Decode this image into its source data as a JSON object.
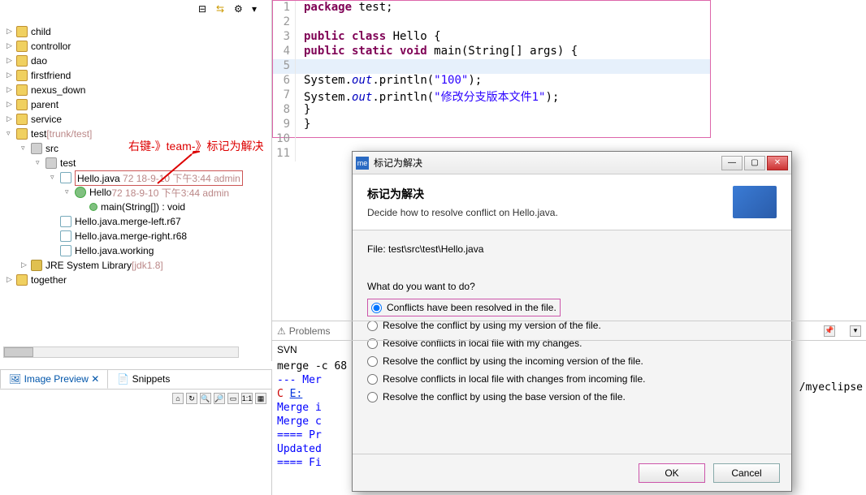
{
  "tree": [
    {
      "ind": 0,
      "arr": "▷",
      "icon": "fld",
      "t": "child"
    },
    {
      "ind": 0,
      "arr": "▷",
      "icon": "fld",
      "t": "controllor"
    },
    {
      "ind": 0,
      "arr": "▷",
      "icon": "fld",
      "t": "dao"
    },
    {
      "ind": 0,
      "arr": "▷",
      "icon": "fld",
      "t": "firstfriend"
    },
    {
      "ind": 0,
      "arr": "▷",
      "icon": "fld",
      "t": "nexus_down"
    },
    {
      "ind": 0,
      "arr": "▷",
      "icon": "fld",
      "t": "parent"
    },
    {
      "ind": 0,
      "arr": "▷",
      "icon": "fld",
      "t": "service"
    },
    {
      "ind": 0,
      "arr": "▿",
      "icon": "fld",
      "t": "test",
      "rev": "[trunk/test]"
    },
    {
      "ind": 1,
      "arr": "▿",
      "icon": "pkg",
      "t": "src"
    },
    {
      "ind": 2,
      "arr": "▿",
      "icon": "pkg",
      "t": "test"
    },
    {
      "ind": 3,
      "arr": "▿",
      "icon": "java",
      "t": "Hello.java",
      "rev": "72   18-9-10 下午3:44   admin",
      "boxed": true
    },
    {
      "ind": 4,
      "arr": "▿",
      "icon": "cls",
      "t": "Hello",
      "rev": "72   18-9-10 下午3:44   admin"
    },
    {
      "ind": 5,
      "arr": "",
      "icon": "mth",
      "t": "main(String[]) : void",
      "mth": true
    },
    {
      "ind": 3,
      "arr": "",
      "icon": "java",
      "t": "Hello.java.merge-left.r67"
    },
    {
      "ind": 3,
      "arr": "",
      "icon": "java",
      "t": "Hello.java.merge-right.r68"
    },
    {
      "ind": 3,
      "arr": "",
      "icon": "java",
      "t": "Hello.java.working"
    },
    {
      "ind": 1,
      "arr": "▷",
      "icon": "lib",
      "t": "JRE System Library",
      "rev": "[jdk1.8]"
    },
    {
      "ind": 0,
      "arr": "▷",
      "icon": "fld",
      "t": "together"
    }
  ],
  "annotation": "右键-》team-》标记为解决",
  "code": {
    "lines": [
      {
        "n": 1,
        "tokens": [
          {
            "c": "kw",
            "t": "package"
          },
          {
            "c": "punc",
            "t": " test;"
          }
        ]
      },
      {
        "n": 2,
        "tokens": []
      },
      {
        "n": 3,
        "tokens": [
          {
            "c": "kw",
            "t": "public class"
          },
          {
            "c": "punc",
            "t": " Hello {"
          }
        ]
      },
      {
        "n": 4,
        "tokens": [
          {
            "c": "kw",
            "t": "public static void"
          },
          {
            "c": "punc",
            "t": " main(String[] args) {"
          }
        ]
      },
      {
        "n": 5,
        "tokens": [],
        "hl": true
      },
      {
        "n": 6,
        "tokens": [
          {
            "c": "punc",
            "t": "        System."
          },
          {
            "c": "fld",
            "t": "out"
          },
          {
            "c": "punc",
            "t": ".println("
          },
          {
            "c": "str",
            "t": "\"100\""
          },
          {
            "c": "punc",
            "t": ");"
          }
        ]
      },
      {
        "n": 7,
        "tokens": [
          {
            "c": "punc",
            "t": "        System."
          },
          {
            "c": "fld",
            "t": "out"
          },
          {
            "c": "punc",
            "t": ".println("
          },
          {
            "c": "str",
            "t": "\"修改分支版本文件1\""
          },
          {
            "c": "punc",
            "t": ");"
          }
        ]
      },
      {
        "n": 8,
        "tokens": [
          {
            "c": "punc",
            "t": "    }"
          }
        ]
      },
      {
        "n": 9,
        "tokens": [
          {
            "c": "punc",
            "t": "}"
          }
        ]
      },
      {
        "n": 10,
        "tokens": []
      },
      {
        "n": 11,
        "tokens": []
      }
    ]
  },
  "dialog": {
    "title": "标记为解决",
    "header_title": "标记为解决",
    "header_sub": "Decide how to resolve conflict on Hello.java.",
    "file_label": "File:",
    "file_path": "test\\src\\test\\Hello.java",
    "question": "What do you want to do?",
    "options": [
      {
        "t": "Conflicts have been resolved in the file.",
        "sel": true,
        "boxed": true
      },
      {
        "t": "Resolve the conflict by using my version of the file."
      },
      {
        "t": "Resolve conflicts in local file with my changes."
      },
      {
        "t": "Resolve the conflict by using the incoming version of the file."
      },
      {
        "t": "Resolve conflicts in local file with changes from incoming file."
      },
      {
        "t": "Resolve the conflict by using the base version of the file."
      }
    ],
    "ok": "OK",
    "cancel": "Cancel"
  },
  "lower_tabs": {
    "active": "Image Preview",
    "inactive": "Snippets"
  },
  "console": {
    "tabs": [
      "Problems"
    ],
    "label": "SVN",
    "lines": [
      {
        "c": "",
        "t": "merge -c 68"
      },
      {
        "c": "c-blue",
        "t": "--- Mer"
      },
      {
        "c": "c-red",
        "t": "C   ",
        "link": "E:"
      },
      {
        "c": "c-blue",
        "t": "Merge i"
      },
      {
        "c": "c-blue",
        "t": "Merge c"
      },
      {
        "c": "c-blue",
        "t": "==== Pr"
      },
      {
        "c": "c-blue",
        "t": "Updated"
      },
      {
        "c": "c-blue",
        "t": "==== Fi"
      }
    ],
    "right_tail": "/myeclipse"
  }
}
